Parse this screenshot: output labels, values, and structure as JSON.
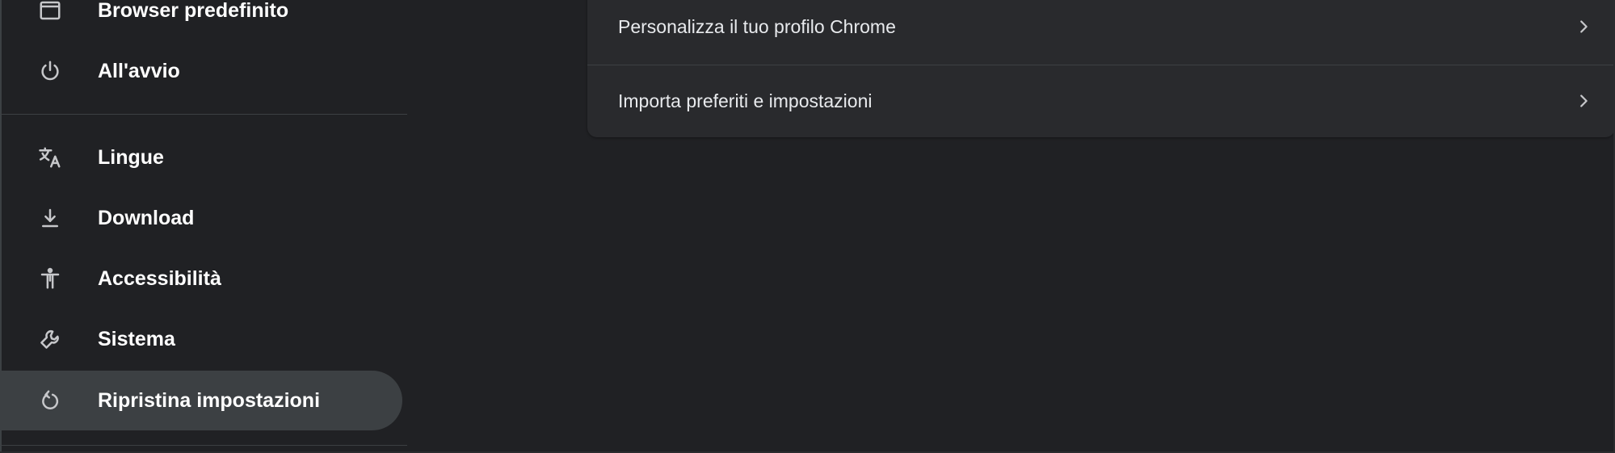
{
  "sidebar": {
    "items": [
      {
        "label": "Browser predefinito",
        "icon": "browser-window-icon"
      },
      {
        "label": "All'avvio",
        "icon": "power-icon"
      },
      {
        "label": "Lingue",
        "icon": "translate-icon"
      },
      {
        "label": "Download",
        "icon": "download-icon"
      },
      {
        "label": "Accessibilità",
        "icon": "accessibility-icon"
      },
      {
        "label": "Sistema",
        "icon": "wrench-icon"
      },
      {
        "label": "Ripristina impostazioni",
        "icon": "reset-icon",
        "active": true
      }
    ]
  },
  "main": {
    "card": {
      "rows": [
        {
          "label": "Personalizza il tuo profilo Chrome",
          "icon": "chevron-right-icon"
        },
        {
          "label": "Importa preferiti e impostazioni",
          "icon": "chevron-right-icon"
        }
      ]
    }
  },
  "colors": {
    "background": "#202124",
    "card": "#292a2d",
    "active_item": "#3c4043",
    "text": "#e8eaed"
  }
}
